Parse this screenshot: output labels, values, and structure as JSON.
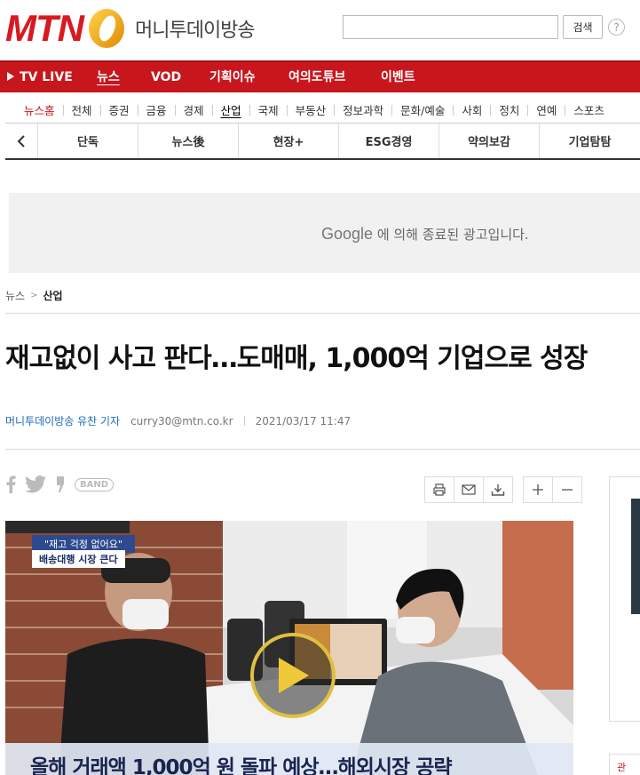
{
  "header": {
    "logo_mtn": "MTN",
    "logo_korean": "머니투데이방송",
    "search_placeholder": "",
    "search_button": "검색",
    "help_label": "?"
  },
  "main_nav": {
    "items": [
      {
        "label": "TV LIVE"
      },
      {
        "label": "뉴스",
        "active": true
      },
      {
        "label": "VOD"
      },
      {
        "label": "기획이슈"
      },
      {
        "label": "여의도튜브"
      },
      {
        "label": "이벤트"
      }
    ]
  },
  "sub_nav": {
    "items": [
      "뉴스홈",
      "전체",
      "증권",
      "금융",
      "경제",
      "산업",
      "국제",
      "부동산",
      "정보과학",
      "문화/예술",
      "사회",
      "정치",
      "연예",
      "스포츠"
    ],
    "active_index": 5
  },
  "tabs": {
    "items": [
      "단독",
      "뉴스後",
      "현장+",
      "ESG경영",
      "약의보감",
      "기업탐탐"
    ]
  },
  "ad": {
    "google": "Google",
    "message": " 에 의해 종료된 광고입니다."
  },
  "breadcrumb": {
    "root": "뉴스",
    "separator": ">",
    "current": "산업"
  },
  "article": {
    "title": "재고없이 사고 판다…도매매, 1,000억 기업으로 성장",
    "reporter": "머니투데이방송 유찬 기자",
    "email": "curry30@mtn.co.kr",
    "date": "2021/03/17 11:47"
  },
  "share": {
    "band_label": "BAND"
  },
  "video": {
    "caption_top": "\"재고 걱정 없어요\"",
    "caption_sub": "배송대행 시장 큰다",
    "banner": "올해 거래액 1,000억 원 돌파 예상…해외시장 공략"
  },
  "sidebar": {
    "label": "관"
  },
  "colors": {
    "brand_red": "#c8161d",
    "reporter_blue": "#1d6bb5",
    "logo_gold": "#f2a900"
  }
}
